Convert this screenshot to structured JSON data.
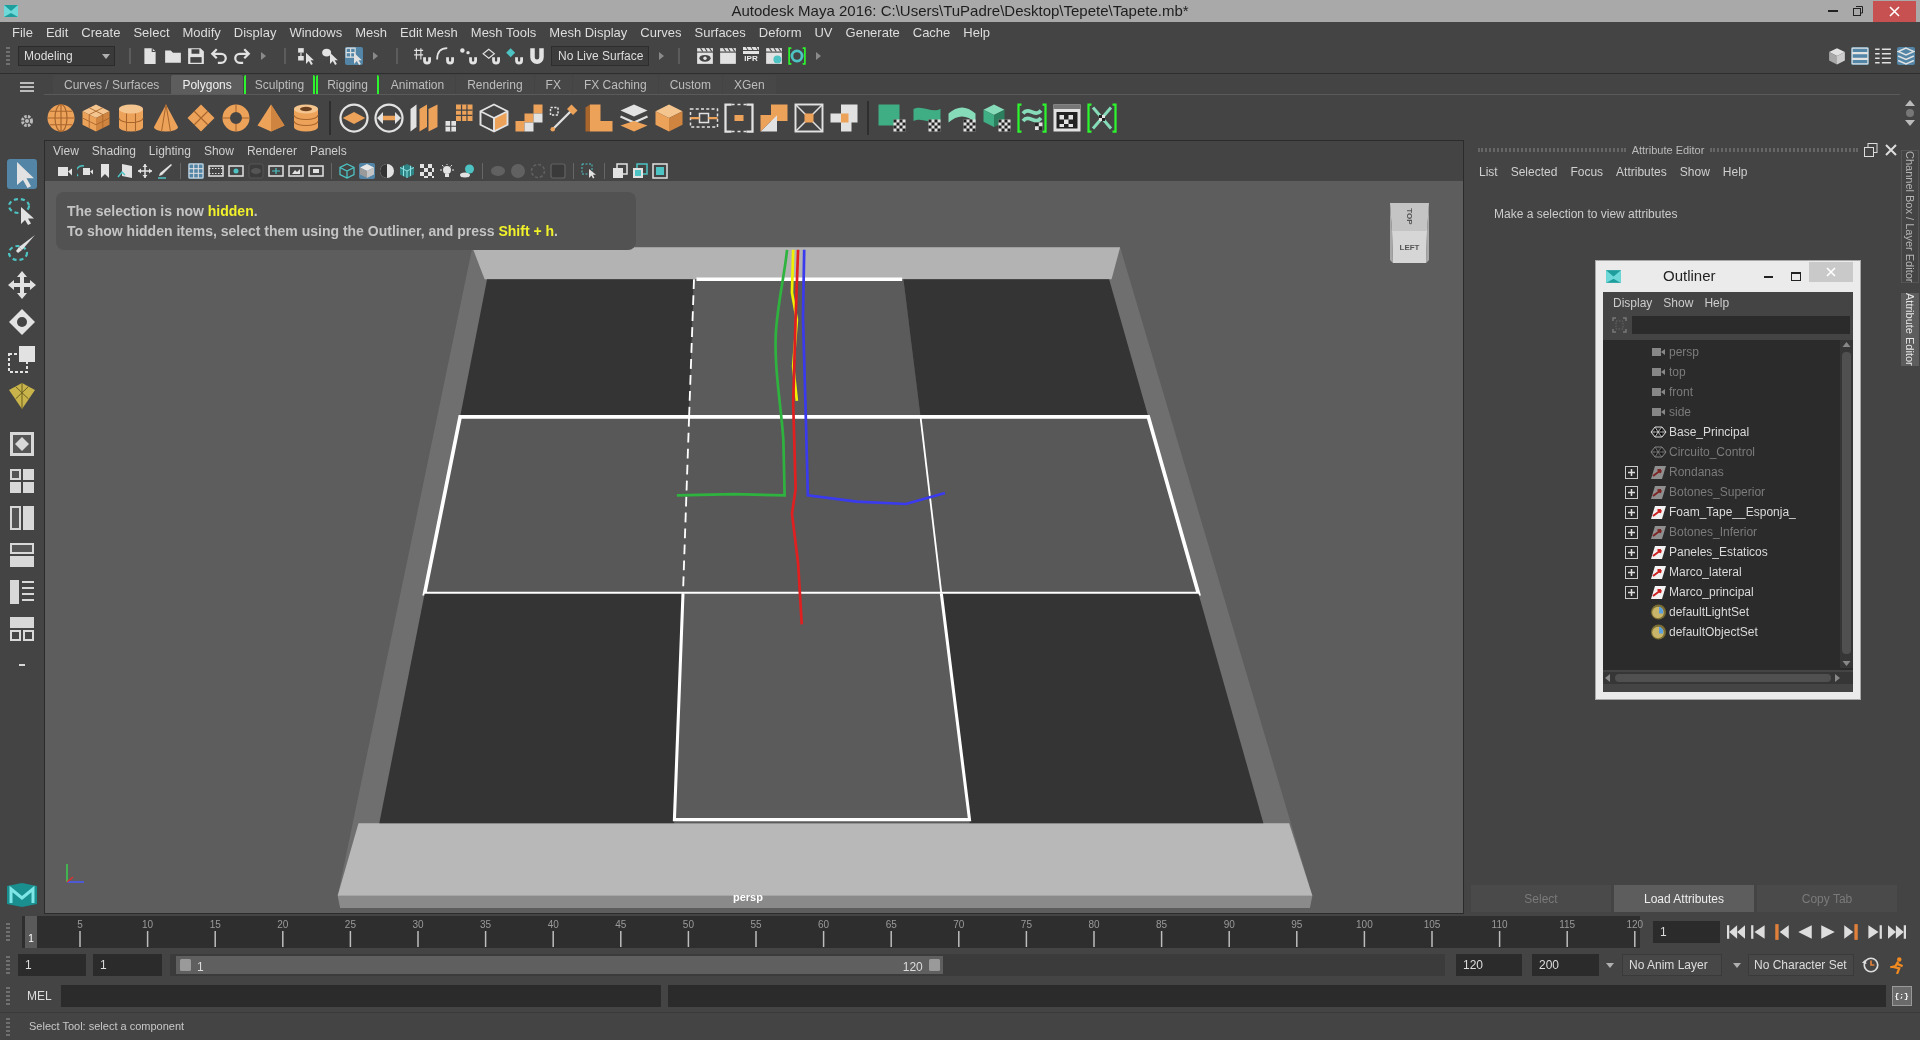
{
  "window": {
    "title": "Autodesk Maya 2016: C:\\Users\\TuPadre\\Desktop\\Tepete\\Tapete.mb*"
  },
  "menu_bar": [
    "File",
    "Edit",
    "Create",
    "Select",
    "Modify",
    "Display",
    "Windows",
    "Mesh",
    "Edit Mesh",
    "Mesh Tools",
    "Mesh Display",
    "Curves",
    "Surfaces",
    "Deform",
    "UV",
    "Generate",
    "Cache",
    "Help"
  ],
  "status_line": {
    "menu_set": "Modeling",
    "selection_modes": [
      {
        "selected": false
      },
      {
        "selected": false
      },
      {
        "selected": true
      }
    ],
    "live_surface": "No Live Surface",
    "ipr_label": "IPR",
    "panel_toggles": [
      {
        "on": false
      },
      {
        "on": true
      },
      {
        "on": false
      },
      {
        "on": true
      }
    ]
  },
  "shelf": {
    "tabs": [
      {
        "label": "Curves / Surfaces",
        "selected": false,
        "highlighted": false
      },
      {
        "label": "Polygons",
        "selected": true,
        "highlighted": false
      },
      {
        "label": "Sculpting",
        "selected": false,
        "highlighted": true
      },
      {
        "label": "Rigging",
        "selected": false,
        "highlighted": true
      },
      {
        "label": "Animation",
        "selected": false,
        "highlighted": false
      },
      {
        "label": "Rendering",
        "selected": false,
        "highlighted": false
      },
      {
        "label": "FX",
        "selected": false,
        "highlighted": false
      },
      {
        "label": "FX Caching",
        "selected": false,
        "highlighted": false
      },
      {
        "label": "Custom",
        "selected": false,
        "highlighted": false
      },
      {
        "label": "XGen",
        "selected": false,
        "highlighted": false
      }
    ]
  },
  "toolbox": {
    "tools": [
      {
        "selected": true
      },
      {
        "selected": false
      },
      {
        "selected": false
      },
      {
        "selected": false
      },
      {
        "selected": false
      },
      {
        "selected": false
      },
      {
        "selected": false
      }
    ]
  },
  "viewport": {
    "menu": [
      "View",
      "Shading",
      "Lighting",
      "Show",
      "Renderer",
      "Panels"
    ],
    "toolbar": [
      {
        "on": false,
        "disabled": false
      },
      {
        "on": false,
        "disabled": false
      },
      {
        "on": false,
        "disabled": false
      },
      {
        "on": false,
        "disabled": false
      },
      {
        "on": false,
        "disabled": false
      },
      {
        "on": false,
        "disabled": false
      },
      {
        "on": true,
        "disabled": false
      },
      {
        "on": false,
        "disabled": false
      },
      {
        "on": false,
        "disabled": false
      },
      {
        "on": false,
        "disabled": true
      },
      {
        "on": false,
        "disabled": false
      },
      {
        "on": false,
        "disabled": false
      },
      {
        "on": false,
        "disabled": false
      },
      {
        "on": false,
        "disabled": false
      },
      {
        "on": true,
        "disabled": false
      },
      {
        "on": false,
        "disabled": false
      },
      {
        "on": false,
        "disabled": false
      },
      {
        "on": false,
        "disabled": false
      },
      {
        "on": false,
        "disabled": false
      },
      {
        "on": false,
        "disabled": false
      },
      {
        "on": false,
        "disabled": true
      },
      {
        "on": false,
        "disabled": true
      },
      {
        "on": false,
        "disabled": true
      },
      {
        "on": false,
        "disabled": true
      },
      {
        "on": false,
        "disabled": false
      },
      {
        "on": false,
        "disabled": false
      },
      {
        "on": false,
        "disabled": false
      },
      {
        "on": false,
        "disabled": false
      }
    ],
    "message": [
      "The selection is now **hidden**.",
      "To show hidden items, select them using the Outliner, and press **Shift + h**."
    ],
    "view_cube": {
      "top": "TOP",
      "front": "LEFT"
    },
    "camera": "persp"
  },
  "attribute_editor": {
    "title": "Attribute Editor",
    "menu": [
      "List",
      "Selected",
      "Focus",
      "Attributes",
      "Show",
      "Help"
    ],
    "message": "Make a selection to view attributes",
    "buttons": [
      {
        "label": "Select",
        "disabled": true
      },
      {
        "label": "Load Attributes",
        "disabled": false
      },
      {
        "label": "Copy Tab",
        "disabled": true
      }
    ]
  },
  "side_tabs": [
    {
      "label": "Channel Box / Layer Editor",
      "selected": false
    },
    {
      "label": "Attribute Editor",
      "selected": true
    }
  ],
  "outliner": {
    "title": "Outliner",
    "menu": [
      "Display",
      "Show",
      "Help"
    ],
    "items": [
      {
        "label": "persp",
        "kind": "camera",
        "hidden": true,
        "expandable": false
      },
      {
        "label": "top",
        "kind": "camera",
        "hidden": true,
        "expandable": false
      },
      {
        "label": "front",
        "kind": "camera",
        "hidden": true,
        "expandable": false
      },
      {
        "label": "side",
        "kind": "camera",
        "hidden": true,
        "expandable": false
      },
      {
        "label": "Base_Principal",
        "kind": "mesh",
        "hidden": false,
        "expandable": false
      },
      {
        "label": "Circuito_Control",
        "kind": "mesh",
        "hidden": true,
        "expandable": false
      },
      {
        "label": "Rondanas",
        "kind": "group",
        "hidden": true,
        "expandable": true
      },
      {
        "label": "Botones_Superior",
        "kind": "group",
        "hidden": true,
        "expandable": true
      },
      {
        "label": "Foam_Tape__Esponja_",
        "kind": "group",
        "hidden": false,
        "expandable": true
      },
      {
        "label": "Botones_Inferior",
        "kind": "group",
        "hidden": true,
        "expandable": true
      },
      {
        "label": "Paneles_Estaticos",
        "kind": "group",
        "hidden": false,
        "expandable": true
      },
      {
        "label": "Marco_lateral",
        "kind": "group",
        "hidden": false,
        "expandable": true
      },
      {
        "label": "Marco_principal",
        "kind": "group",
        "hidden": false,
        "expandable": true
      },
      {
        "label": "defaultLightSet",
        "kind": "set",
        "hidden": false,
        "expandable": false
      },
      {
        "label": "defaultObjectSet",
        "kind": "set",
        "hidden": false,
        "expandable": false
      }
    ]
  },
  "time_slider": {
    "current_frame": "1",
    "labels": [
      "5",
      "10",
      "15",
      "20",
      "25",
      "30",
      "35",
      "40",
      "45",
      "50",
      "55",
      "60",
      "65",
      "70",
      "75",
      "80",
      "85",
      "90",
      "95",
      "100",
      "105",
      "110",
      "115",
      "120"
    ],
    "frame_field": "1"
  },
  "range_slider": {
    "start": "1",
    "playback_start": "1",
    "range_start": "1",
    "range_end": "120",
    "playback_end": "120",
    "end": "200",
    "level": 0.6,
    "anim_layer": "No Anim Layer",
    "character_set": "No Character Set"
  },
  "command_line": {
    "language": "MEL",
    "script_editor_label": "{;}"
  },
  "help_line": "Select Tool: select a component"
}
